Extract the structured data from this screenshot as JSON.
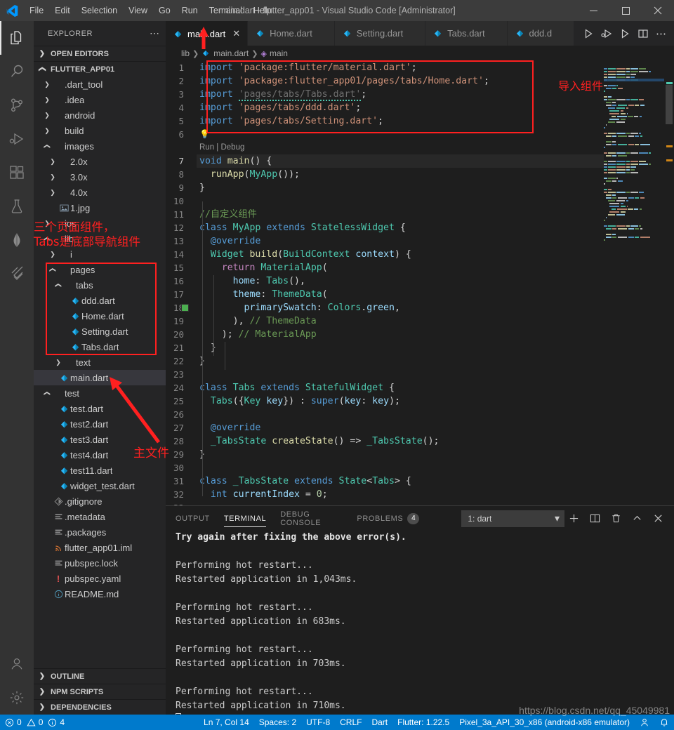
{
  "window": {
    "title": "main.dart - flutter_app01 - Visual Studio Code [Administrator]",
    "minimize_label": "─",
    "maximize_label": "☐",
    "close_label": "✕",
    "logo_icon": "vscode-logo-icon"
  },
  "menubar": {
    "items": [
      "File",
      "Edit",
      "Selection",
      "View",
      "Go",
      "Run",
      "Terminal",
      "Help"
    ]
  },
  "activitybar": {
    "items": [
      {
        "name": "explorer",
        "icon": "files-icon",
        "active": true
      },
      {
        "name": "search",
        "icon": "search-icon",
        "active": false
      },
      {
        "name": "source-control",
        "icon": "source-control-icon",
        "active": false
      },
      {
        "name": "run-and-debug",
        "icon": "debug-icon",
        "active": false
      },
      {
        "name": "extensions",
        "icon": "extensions-icon",
        "active": false
      },
      {
        "name": "testing",
        "icon": "flask-icon",
        "active": false
      },
      {
        "name": "mongodb",
        "icon": "leaf-icon",
        "active": false
      },
      {
        "name": "flutter",
        "icon": "flutter-icon",
        "active": false
      }
    ],
    "bottom_items": [
      {
        "name": "accounts",
        "icon": "account-icon"
      },
      {
        "name": "manage",
        "icon": "gear-icon"
      }
    ]
  },
  "sidebar": {
    "header": "EXPLORER",
    "more_actions": "⋯",
    "sections": {
      "open_editors": "OPEN EDITORS",
      "project": "FLUTTER_APP01"
    },
    "bottom_sections": [
      "OUTLINE",
      "NPM SCRIPTS",
      "DEPENDENCIES"
    ],
    "tree": [
      {
        "label": ".dart_tool",
        "depth": 1,
        "kind": "folder",
        "state": "collapsed"
      },
      {
        "label": ".idea",
        "depth": 1,
        "kind": "folder",
        "state": "collapsed"
      },
      {
        "label": "android",
        "depth": 1,
        "kind": "folder",
        "state": "collapsed"
      },
      {
        "label": "build",
        "depth": 1,
        "kind": "folder",
        "state": "collapsed"
      },
      {
        "label": "images",
        "depth": 1,
        "kind": "folder",
        "state": "expanded"
      },
      {
        "label": "2.0x",
        "depth": 2,
        "kind": "folder",
        "state": "collapsed"
      },
      {
        "label": "3.0x",
        "depth": 2,
        "kind": "folder",
        "state": "collapsed"
      },
      {
        "label": "4.0x",
        "depth": 2,
        "kind": "folder",
        "state": "collapsed"
      },
      {
        "label": "1.jpg",
        "depth": 2,
        "kind": "image"
      },
      {
        "label": "ios",
        "depth": 1,
        "kind": "folder",
        "state": "collapsed"
      },
      {
        "label": "lib",
        "depth": 1,
        "kind": "folder",
        "state": "expanded"
      },
      {
        "label": "i",
        "depth": 2,
        "kind": "folder",
        "state": "collapsed"
      },
      {
        "label": "pages",
        "depth": 2,
        "kind": "folder",
        "state": "expanded"
      },
      {
        "label": "tabs",
        "depth": 3,
        "kind": "folder",
        "state": "expanded"
      },
      {
        "label": "ddd.dart",
        "depth": 4,
        "kind": "dart"
      },
      {
        "label": "Home.dart",
        "depth": 4,
        "kind": "dart"
      },
      {
        "label": "Setting.dart",
        "depth": 4,
        "kind": "dart"
      },
      {
        "label": "Tabs.dart",
        "depth": 4,
        "kind": "dart"
      },
      {
        "label": "text",
        "depth": 3,
        "kind": "folder",
        "state": "collapsed"
      },
      {
        "label": "main.dart",
        "depth": 2,
        "kind": "dart",
        "selected": true
      },
      {
        "label": "test",
        "depth": 1,
        "kind": "folder",
        "state": "expanded"
      },
      {
        "label": "test.dart",
        "depth": 2,
        "kind": "dart"
      },
      {
        "label": "test2.dart",
        "depth": 2,
        "kind": "dart"
      },
      {
        "label": "test3.dart",
        "depth": 2,
        "kind": "dart"
      },
      {
        "label": "test4.dart",
        "depth": 2,
        "kind": "dart"
      },
      {
        "label": "test11.dart",
        "depth": 2,
        "kind": "dart"
      },
      {
        "label": "widget_test.dart",
        "depth": 2,
        "kind": "dart"
      },
      {
        "label": ".gitignore",
        "depth": 1,
        "kind": "git"
      },
      {
        "label": ".metadata",
        "depth": 1,
        "kind": "config"
      },
      {
        "label": ".packages",
        "depth": 1,
        "kind": "config"
      },
      {
        "label": "flutter_app01.iml",
        "depth": 1,
        "kind": "xml"
      },
      {
        "label": "pubspec.lock",
        "depth": 1,
        "kind": "config"
      },
      {
        "label": "pubspec.yaml",
        "depth": 1,
        "kind": "yaml"
      },
      {
        "label": "README.md",
        "depth": 1,
        "kind": "info"
      }
    ]
  },
  "editor": {
    "tabs": [
      {
        "label": "main.dart",
        "icon": "dart-icon",
        "active": true,
        "close_label": "✕"
      },
      {
        "label": "Home.dart",
        "icon": "dart-icon",
        "active": false
      },
      {
        "label": "Setting.dart",
        "icon": "dart-icon",
        "active": false
      },
      {
        "label": "Tabs.dart",
        "icon": "dart-icon",
        "active": false
      },
      {
        "label": "ddd.d",
        "icon": "dart-icon",
        "active": false
      }
    ],
    "tab_actions": [
      {
        "name": "run-file-button",
        "icon": "play-icon"
      },
      {
        "name": "run-and-debug-button",
        "icon": "debug-play-icon"
      },
      {
        "name": "run-without-debug-button",
        "icon": "play-outline-icon"
      },
      {
        "name": "split-editor-button",
        "icon": "split-editor-icon"
      },
      {
        "name": "more-actions-button",
        "icon": "ellipsis-icon"
      }
    ],
    "breadcrumb": [
      "lib",
      "main.dart",
      "main"
    ],
    "codelens": "Run | Debug",
    "cursor_line": 7,
    "color_swatch_line": 18,
    "color_swatch_hex": "#4caf50",
    "lines": [
      {
        "n": 1,
        "html": "<span class=\"k\">import</span> <span class=\"s\">'package:flutter/material.dart'</span><span class=\"p\">;</span>"
      },
      {
        "n": 2,
        "html": "<span class=\"k\">import</span> <span class=\"s\">'package:flutter_app01/pages/tabs/Home.dart'</span><span class=\"p\">;</span>"
      },
      {
        "n": 3,
        "html": "<span class=\"k\">import</span> <span class=\"sd squig\">'pages/tabs/Tabs.dart'</span><span class=\"p\">;</span>"
      },
      {
        "n": 4,
        "html": "<span class=\"k\">import</span> <span class=\"s\">'pages/tabs/ddd.dart'</span><span class=\"p\">;</span>"
      },
      {
        "n": 5,
        "html": "<span class=\"k\">import</span> <span class=\"s\">'pages/tabs/Setting.dart'</span><span class=\"p\">;</span>"
      },
      {
        "n": 6,
        "html": ""
      },
      {
        "n": 7,
        "html": "<span class=\"k\">void</span> <span class=\"f\">main</span><span class=\"p\">() {</span>"
      },
      {
        "n": 8,
        "html": "  <span class=\"f\">runApp</span><span class=\"p\">(</span><span class=\"t\">MyApp</span><span class=\"p\">());</span>"
      },
      {
        "n": 9,
        "html": "<span class=\"p\">}</span>"
      },
      {
        "n": 10,
        "html": ""
      },
      {
        "n": 11,
        "html": "<span class=\"c\">//自定义组件</span>"
      },
      {
        "n": 12,
        "html": "<span class=\"k\">class</span> <span class=\"t\">MyApp</span> <span class=\"k\">extends</span> <span class=\"t\">StatelessWidget</span> <span class=\"p\">{</span>"
      },
      {
        "n": 13,
        "html": "  <span class=\"k\">@override</span>"
      },
      {
        "n": 14,
        "html": "  <span class=\"t\">Widget</span> <span class=\"f\">build</span><span class=\"p\">(</span><span class=\"t\">BuildContext</span> <span class=\"v\">context</span><span class=\"p\">) {</span>"
      },
      {
        "n": 15,
        "html": "    <span class=\"kp\">return</span> <span class=\"t\">MaterialApp</span><span class=\"p\">(</span>"
      },
      {
        "n": 16,
        "html": "      <span class=\"v\">home</span><span class=\"p\">: </span><span class=\"t\">Tabs</span><span class=\"p\">(),</span>"
      },
      {
        "n": 17,
        "html": "      <span class=\"v\">theme</span><span class=\"p\">: </span><span class=\"t\">ThemeData</span><span class=\"p\">(</span>"
      },
      {
        "n": 18,
        "html": "        <span class=\"v\">primarySwatch</span><span class=\"p\">: </span><span class=\"t\">Colors</span><span class=\"p\">.</span><span class=\"v\">green</span><span class=\"p\">,</span>"
      },
      {
        "n": 19,
        "html": "      <span class=\"p\">), </span><span class=\"cm\">// ThemeData</span>"
      },
      {
        "n": 20,
        "html": "    <span class=\"p\">); </span><span class=\"cm\">// MaterialApp</span>"
      },
      {
        "n": 21,
        "html": "  <span class=\"p\">}</span>"
      },
      {
        "n": 22,
        "html": "<span class=\"p\">}</span>"
      },
      {
        "n": 23,
        "html": ""
      },
      {
        "n": 24,
        "html": "<span class=\"k\">class</span> <span class=\"t\">Tabs</span> <span class=\"k\">extends</span> <span class=\"t\">StatefulWidget</span> <span class=\"p\">{</span>"
      },
      {
        "n": 25,
        "html": "  <span class=\"t\">Tabs</span><span class=\"p\">({</span><span class=\"t\">Key</span> <span class=\"v\">key</span><span class=\"p\">}) : </span><span class=\"k\">super</span><span class=\"p\">(</span><span class=\"v\">key</span><span class=\"p\">: </span><span class=\"v\">key</span><span class=\"p\">);</span>"
      },
      {
        "n": 26,
        "html": ""
      },
      {
        "n": 27,
        "html": "  <span class=\"k\">@override</span>"
      },
      {
        "n": 28,
        "html": "  <span class=\"t\">_TabsState</span> <span class=\"f\">createState</span><span class=\"p\">() =&gt; </span><span class=\"t\">_TabsState</span><span class=\"p\">();</span>"
      },
      {
        "n": 29,
        "html": "<span class=\"p\">}</span>"
      },
      {
        "n": 30,
        "html": ""
      },
      {
        "n": 31,
        "html": "<span class=\"k\">class</span> <span class=\"t\">_TabsState</span> <span class=\"k\">extends</span> <span class=\"t\">State</span><span class=\"p\">&lt;</span><span class=\"t\">Tabs</span><span class=\"p\">&gt; {</span>"
      },
      {
        "n": 32,
        "html": "  <span class=\"k\">int</span> <span class=\"v\">currentIndex</span> <span class=\"p\">= </span><span class=\"n\">0</span><span class=\"p\">;</span>"
      },
      {
        "n": 33,
        "html": ""
      }
    ]
  },
  "panel": {
    "tabs": [
      {
        "label": "OUTPUT",
        "active": false
      },
      {
        "label": "TERMINAL",
        "active": true
      },
      {
        "label": "DEBUG CONSOLE",
        "active": false
      },
      {
        "label": "PROBLEMS",
        "active": false,
        "badge": "4"
      }
    ],
    "terminal_select": {
      "value": "1: dart",
      "chevron": "⌄"
    },
    "actions": [
      {
        "name": "new-terminal-button",
        "icon": "plus-icon",
        "glyph": "＋"
      },
      {
        "name": "split-terminal-button",
        "icon": "split-icon",
        "glyph": "◫"
      },
      {
        "name": "kill-terminal-button",
        "icon": "trash-icon",
        "glyph": "🗑"
      },
      {
        "name": "maximize-panel-button",
        "icon": "chevron-up-icon",
        "glyph": "∧"
      },
      {
        "name": "close-panel-button",
        "icon": "close-icon",
        "glyph": "✕"
      }
    ],
    "terminal_lines": [
      {
        "text": "Try again after fixing the above error(s).",
        "bold": true
      },
      {
        "text": ""
      },
      {
        "text": "Performing hot restart..."
      },
      {
        "text": "Restarted application in 1,043ms."
      },
      {
        "text": ""
      },
      {
        "text": "Performing hot restart..."
      },
      {
        "text": "Restarted application in 683ms."
      },
      {
        "text": ""
      },
      {
        "text": "Performing hot restart..."
      },
      {
        "text": "Restarted application in 703ms."
      },
      {
        "text": ""
      },
      {
        "text": "Performing hot restart..."
      },
      {
        "text": "Restarted application in 710ms."
      }
    ]
  },
  "statusbar": {
    "errors": "0",
    "warnings": "0",
    "infos": "4",
    "cursor": "Ln 7, Col 14",
    "indentation": "Spaces: 2",
    "encoding": "UTF-8",
    "eol": "CRLF",
    "language": "Dart",
    "flutter": "Flutter: 1.22.5",
    "device": "Pixel_3a_API_30_x86 (android-x86 emulator)",
    "accounts_icon": "account-icon",
    "bell_icon": "bell-icon"
  },
  "annotations": [
    {
      "name": "import-annotation",
      "text": "导入组件"
    },
    {
      "name": "pages-annotation",
      "text": "三个页面组件，\nTabs是底部导航组件"
    },
    {
      "name": "mainfile-annotation",
      "text": "主文件"
    }
  ],
  "watermark": "https://blog.csdn.net/qq_45049981",
  "colors": {
    "accent": "#007acc",
    "annotation": "#ff2020",
    "editor_bg": "#1e1e1e",
    "sidebar_bg": "#252526",
    "activitybar_bg": "#333333"
  }
}
